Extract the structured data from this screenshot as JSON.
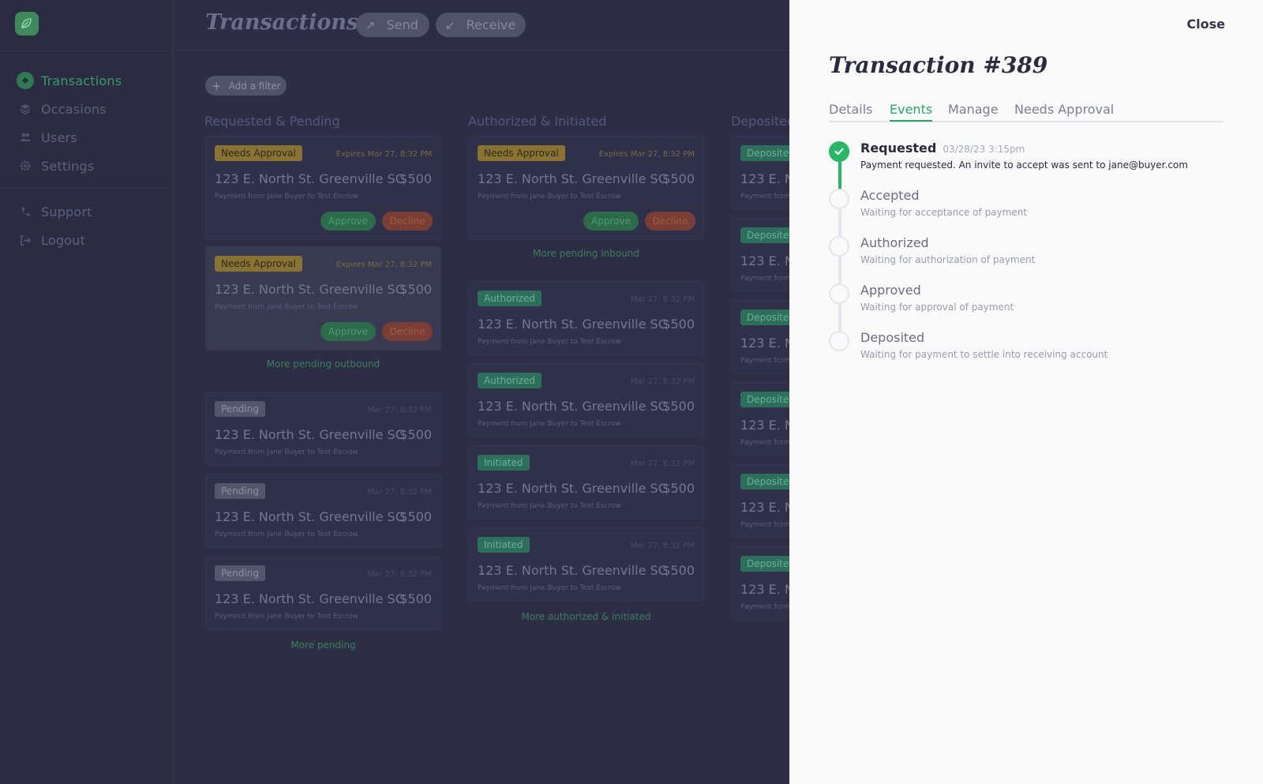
{
  "sidebar": {
    "nav": [
      {
        "label": "Transactions",
        "icon": "transactions-icon",
        "active": true
      },
      {
        "label": "Occasions",
        "icon": "layers-icon"
      },
      {
        "label": "Users",
        "icon": "users-icon"
      },
      {
        "label": "Settings",
        "icon": "gear-icon"
      }
    ],
    "nav2": [
      {
        "label": "Support",
        "icon": "phone-icon"
      },
      {
        "label": "Logout",
        "icon": "logout-icon"
      }
    ]
  },
  "header": {
    "title": "Transactions",
    "send_label": "Send",
    "receive_label": "Receive"
  },
  "filter_label": "Add a filter",
  "columns": {
    "col1_title": "Requested & Pending",
    "col2_title": "Authorized & Initiated",
    "col3_title": "Deposited"
  },
  "cards": {
    "address": "123 E. North St. Greenville SC",
    "short_address": "123 E. N",
    "amount": "$500",
    "sub": "Payment from Jane Buyer to Test Escrow",
    "short_sub": "Payment from",
    "expires": "Expires Mar 27, 8:32 PM",
    "date": "Mar 27, 8:32 PM",
    "needs_approval": "Needs Approval",
    "pending": "Pending",
    "authorized": "Authorized",
    "initiated": "Initiated",
    "deposited": "Deposited",
    "approve": "Approve",
    "decline": "Decline"
  },
  "links": {
    "more_pending_outbound": "More pending outbound",
    "more_pending": "More pending",
    "more_pending_inbound": "More pending inbound",
    "more_authorized": "More authorized & initiated"
  },
  "drawer": {
    "close_label": "Close",
    "title": "Transaction #389",
    "tabs": [
      "Details",
      "Events",
      "Manage",
      "Needs Approval"
    ],
    "active_tab": "Events",
    "steps": [
      {
        "name": "Requested",
        "time": "03/28/23 3:15pm",
        "desc": "Payment requested. An invite to accept was sent to jane@buyer.com",
        "done": true
      },
      {
        "name": "Accepted",
        "desc": "Waiting for acceptance of payment",
        "done": false
      },
      {
        "name": "Authorized",
        "desc": "Waiting for authorization of payment",
        "done": false
      },
      {
        "name": "Approved",
        "desc": "Waiting for approval of payment",
        "done": false
      },
      {
        "name": "Deposited",
        "desc": "Waiting for payment to settle into receiving account",
        "done": false
      }
    ]
  },
  "colors": {
    "accent": "#27b765",
    "overlay_bg": "#2d2e45",
    "drawer_bg": "#fafafa"
  }
}
